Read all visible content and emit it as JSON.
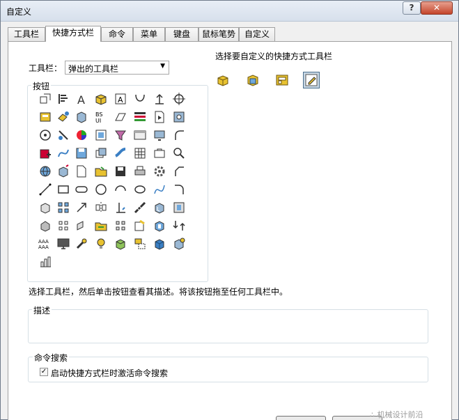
{
  "window": {
    "title": "自定义",
    "help_label": "?",
    "close_label": "✕"
  },
  "tabs": [
    {
      "label": "工具栏"
    },
    {
      "label": "快捷方式栏"
    },
    {
      "label": "命令"
    },
    {
      "label": "菜单"
    },
    {
      "label": "键盘"
    },
    {
      "label": "鼠标笔势"
    },
    {
      "label": "自定义"
    }
  ],
  "toolbar_select": {
    "label": "工具栏：",
    "value": "弹出的工具栏"
  },
  "shortcut_toolbar_label": "选择要自定义的快捷方式工具栏",
  "buttons_group": {
    "title": "按钮"
  },
  "hint": "选择工具栏，然后单击按钮查看其描述。将该按钮拖至任何工具栏中。",
  "description_group": {
    "title": "描述",
    "text": ""
  },
  "command_search": {
    "title": "命令搜索",
    "checkbox_label": "启动快捷方式栏时激活命令搜索",
    "checked": true,
    "check_glyph": "✓"
  },
  "watermark": "∴ 机械设计前沿",
  "colors": {
    "accent_yellow": "#e8c230",
    "accent_blue": "#3a7fc4",
    "selection": "#c8d7e4"
  }
}
